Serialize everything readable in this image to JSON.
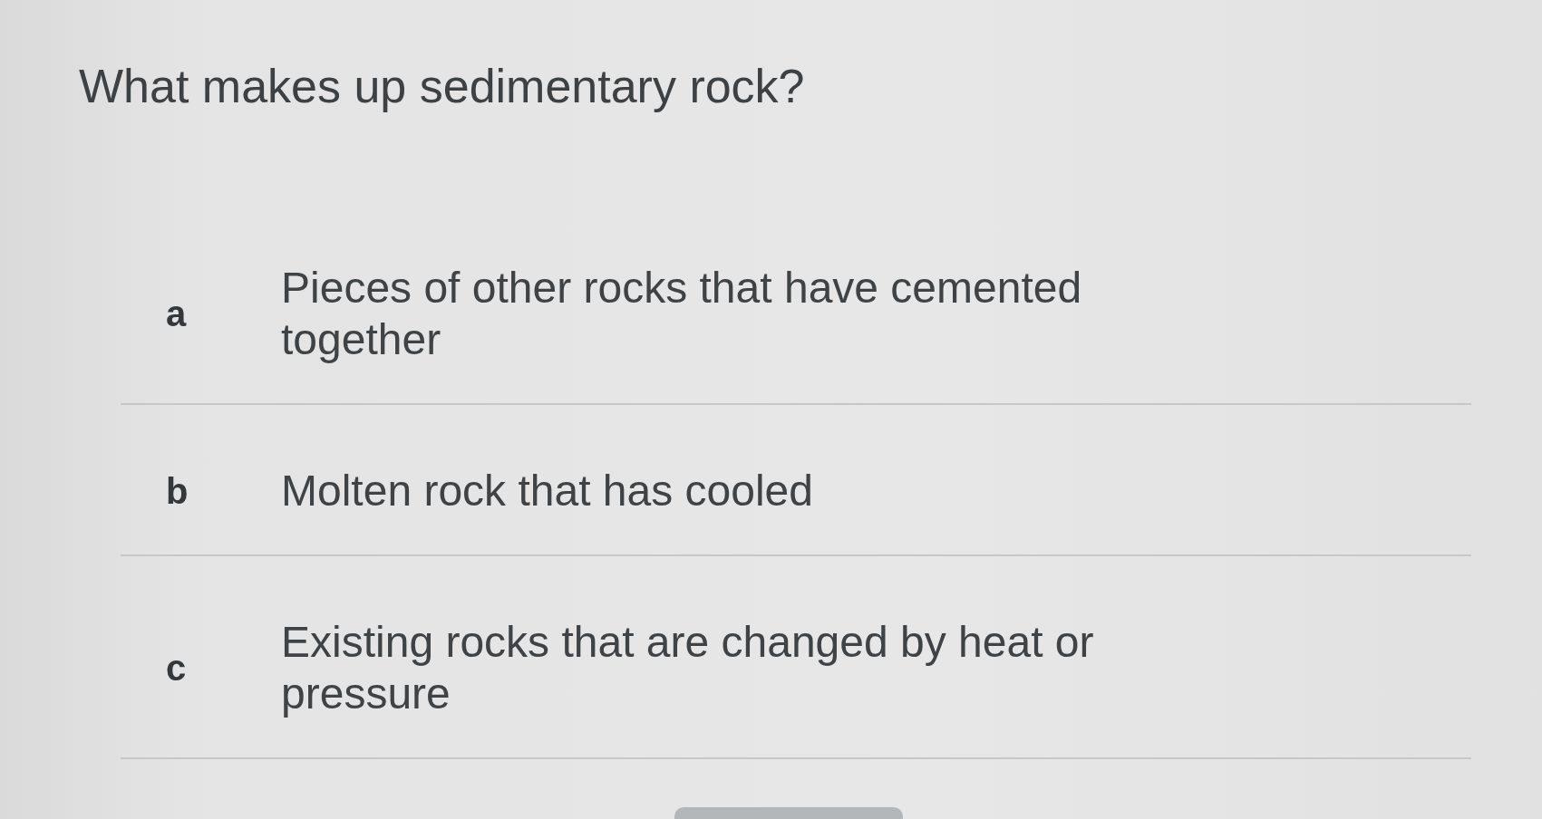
{
  "question": "What makes up sedimentary rock?",
  "options": [
    {
      "letter": "a",
      "text": "Pieces of other rocks that have cemented together",
      "selected": false
    },
    {
      "letter": "b",
      "text": "Molten rock that has cooled",
      "selected": false
    },
    {
      "letter": "c",
      "text": "Existing rocks that are changed by heat or pressure",
      "selected": false
    }
  ]
}
